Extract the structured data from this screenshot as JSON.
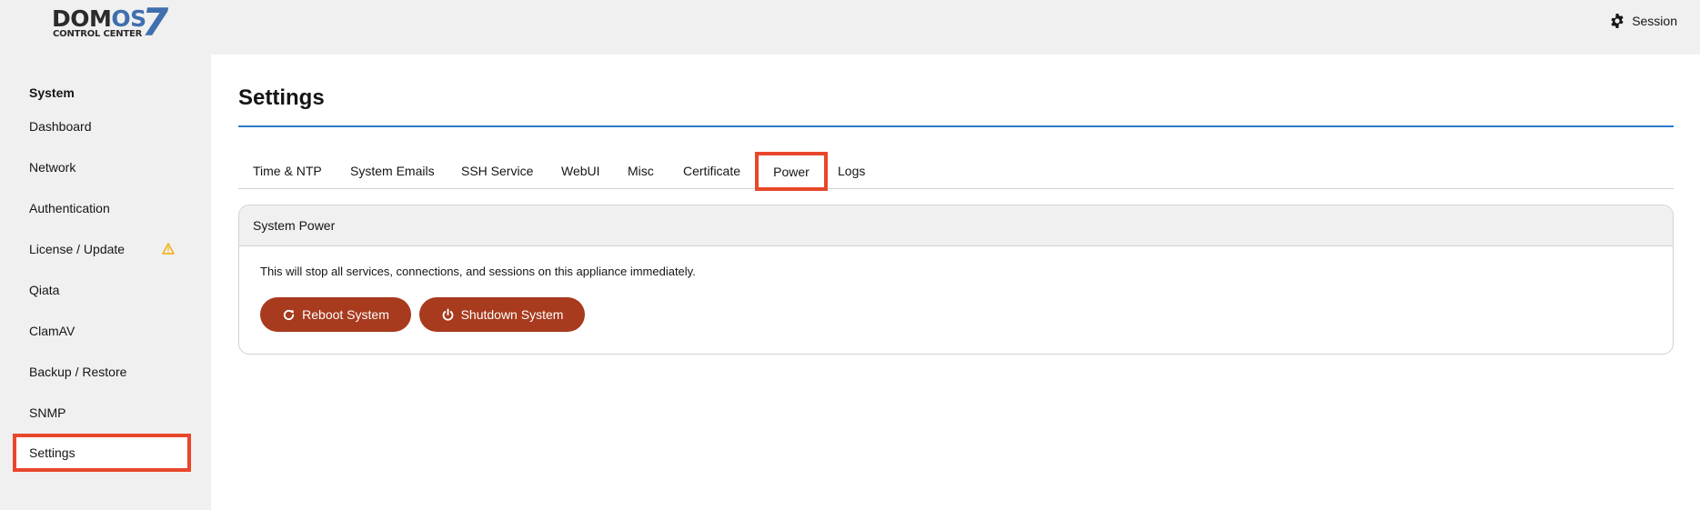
{
  "header": {
    "logo_word_dom": "DOM",
    "logo_word_os": "OS",
    "logo_version": "7",
    "logo_subtitle": "CONTROL CENTER",
    "session_label": "Session",
    "session_icon": "gear-icon"
  },
  "sidebar": {
    "section_title": "System",
    "items": [
      {
        "label": "Dashboard"
      },
      {
        "label": "Network"
      },
      {
        "label": "Authentication"
      },
      {
        "label": "License / Update",
        "badge_icon": "warning-icon"
      },
      {
        "label": "Qiata"
      },
      {
        "label": "ClamAV"
      },
      {
        "label": "Backup / Restore"
      },
      {
        "label": "SNMP"
      },
      {
        "label": "Settings",
        "active": true
      }
    ]
  },
  "main": {
    "title": "Settings",
    "tabs": [
      {
        "label": "Time & NTP"
      },
      {
        "label": "System Emails"
      },
      {
        "label": "SSH Service"
      },
      {
        "label": "WebUI"
      },
      {
        "label": "Misc"
      },
      {
        "label": "Certificate"
      },
      {
        "label": "Power",
        "active": true
      },
      {
        "label": "Logs"
      }
    ],
    "panel": {
      "title": "System Power",
      "description": "This will stop all services, connections, and sessions on this appliance immediately.",
      "reboot_label": "Reboot System",
      "reboot_icon": "refresh-icon",
      "shutdown_label": "Shutdown System",
      "shutdown_icon": "power-icon"
    }
  },
  "colors": {
    "accent_blue": "#2b7bc9",
    "danger_button": "#a83a1e",
    "highlight_box": "#e8472b",
    "warning": "#f0ab00"
  }
}
